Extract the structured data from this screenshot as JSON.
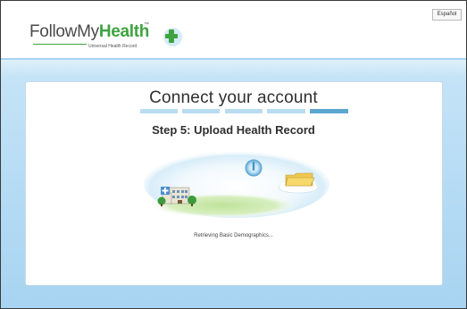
{
  "header": {
    "logo_follow": "FollowMy",
    "logo_health": "Health",
    "logo_tm": "™",
    "logo_tagline": "Universal Health Record",
    "language_button": "Español"
  },
  "main": {
    "title": "Connect your account",
    "step_title": "Step 5: Upload Health Record",
    "status": "Retrieving Basic Demographics...",
    "progress": {
      "total_steps": 5,
      "current_step": 5
    }
  },
  "colors": {
    "brand_green": "#3fa33f",
    "progress_inactive": "#b9dcf1",
    "progress_active": "#5ba7d2",
    "background_blue": "#b3daf4"
  },
  "icons": [
    "plus-badge-icon",
    "hospital-icon",
    "sync-spinner-icon",
    "folder-cloud-icon"
  ]
}
